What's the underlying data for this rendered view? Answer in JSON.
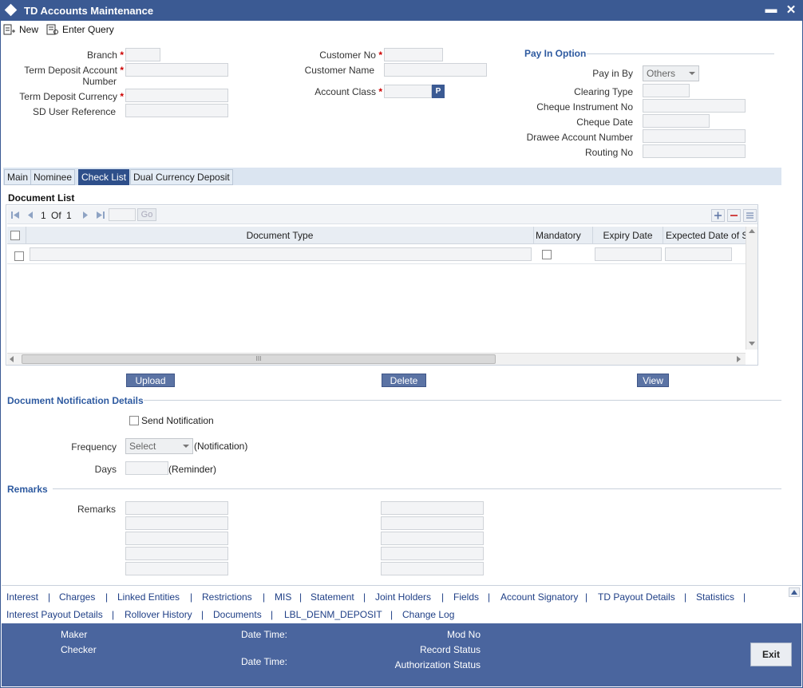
{
  "window": {
    "title": "TD Accounts Maintenance",
    "minimize": "▬",
    "close": "✕"
  },
  "toolbar": {
    "new_label": "New",
    "enter_query_label": "Enter Query"
  },
  "form": {
    "branch_label": "Branch",
    "td_account_label_1": "Term Deposit Account",
    "td_account_label_2": "Number",
    "td_currency_label": "Term Deposit Currency",
    "sd_user_ref_label": "SD User Reference",
    "customer_no_label": "Customer No",
    "customer_name_label": "Customer Name",
    "account_class_label": "Account Class",
    "lov_button": "P",
    "required_mark": "*"
  },
  "pay_in": {
    "title": "Pay In Option",
    "pay_in_by_label": "Pay in By",
    "pay_in_by_value": "Others",
    "clearing_type_label": "Clearing Type",
    "cheque_instrument_label": "Cheque Instrument No",
    "cheque_date_label": "Cheque Date",
    "drawee_account_label": "Drawee Account Number",
    "routing_no_label": "Routing No"
  },
  "tabs": [
    {
      "label": "Main"
    },
    {
      "label": "Nominee"
    },
    {
      "label": "Check List"
    },
    {
      "label": "Dual Currency Deposit"
    }
  ],
  "document_list": {
    "title": "Document List",
    "page_current": "1",
    "page_of": "Of",
    "page_total": "1",
    "go_label": "Go",
    "columns": [
      "Document Type",
      "Mandatory",
      "Expiry Date",
      "Expected Date of S"
    ],
    "scroll_mark": "III"
  },
  "actions": {
    "upload": "Upload",
    "delete": "Delete",
    "view": "View"
  },
  "notification": {
    "title": "Document Notification Details",
    "send_label": "Send Notification",
    "frequency_label": "Frequency",
    "frequency_value": "Select",
    "frequency_suffix": "(Notification)",
    "days_label": "Days",
    "days_suffix": "(Reminder)"
  },
  "remarks": {
    "title": "Remarks",
    "label": "Remarks"
  },
  "links_row1": [
    "Interest",
    "Charges",
    "Linked Entities",
    "Restrictions",
    "MIS",
    "Statement",
    "Joint Holders",
    "Fields",
    "Account Signatory",
    "TD Payout Details",
    "Statistics"
  ],
  "links_row2": [
    "Interest Payout Details",
    "Rollover History",
    "Documents",
    "LBL_DENM_DEPOSIT",
    "Change Log"
  ],
  "link_separator": "|",
  "footer": {
    "maker": "Maker",
    "checker": "Checker",
    "date_time_1": "Date Time:",
    "date_time_2": "Date Time:",
    "mod_no": "Mod No",
    "record_status": "Record Status",
    "authorization_status": "Authorization Status",
    "exit": "Exit"
  }
}
